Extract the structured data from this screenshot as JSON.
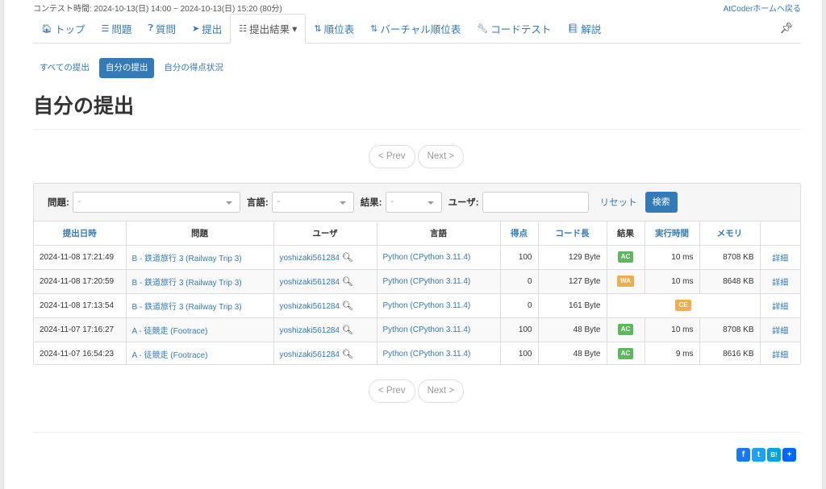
{
  "header": {
    "contest_time": "コンテスト時間: 2024-10-13(日) 14:00 ~ 2024-10-13(日) 15:20 (80分)",
    "home_link": "AtCoderホームへ戻る"
  },
  "nav": {
    "top": "トップ",
    "tasks": "問題",
    "clar": "質問",
    "submit": "提出",
    "results": "提出結果",
    "standings": "順位表",
    "virtual": "バーチャル順位表",
    "codetest": "コードテスト",
    "editorial": "解説"
  },
  "subnav": {
    "all": "すべての提出",
    "mine": "自分の提出",
    "score": "自分の得点状況"
  },
  "page_title": "自分の提出",
  "pager": {
    "prev": "< Prev",
    "next": "Next >"
  },
  "filter": {
    "task_label": "問題:",
    "task_value": "-",
    "lang_label": "言語:",
    "lang_value": "-",
    "status_label": "結果:",
    "status_value": "-",
    "user_label": "ユーザ:",
    "reset": "リセット",
    "search": "検索"
  },
  "table": {
    "headers": [
      "提出日時",
      "問題",
      "ユーザ",
      "言語",
      "得点",
      "コード長",
      "結果",
      "実行時間",
      "メモリ",
      ""
    ],
    "rows": [
      {
        "time": "2024-11-08 17:21:49",
        "task": "B - 鉄道旅行 3 (Railway Trip 3)",
        "user": "yoshizaki561284",
        "lang": "Python (CPython 3.11.4)",
        "score": "100",
        "len": "129 Byte",
        "status": "AC",
        "exec": "10 ms",
        "mem": "8708 KB",
        "detail": "詳細"
      },
      {
        "time": "2024-11-08 17:20:59",
        "task": "B - 鉄道旅行 3 (Railway Trip 3)",
        "user": "yoshizaki561284",
        "lang": "Python (CPython 3.11.4)",
        "score": "0",
        "len": "127 Byte",
        "status": "WA",
        "exec": "10 ms",
        "mem": "8648 KB",
        "detail": "詳細"
      },
      {
        "time": "2024-11-08 17:13:54",
        "task": "B - 鉄道旅行 3 (Railway Trip 3)",
        "user": "yoshizaki561284",
        "lang": "Python (CPython 3.11.4)",
        "score": "0",
        "len": "161 Byte",
        "status": "CE",
        "exec": "",
        "mem": "",
        "detail": "詳細"
      },
      {
        "time": "2024-11-07 17:16:27",
        "task": "A - 徒競走 (Footrace)",
        "user": "yoshizaki561284",
        "lang": "Python (CPython 3.11.4)",
        "score": "100",
        "len": "48 Byte",
        "status": "AC",
        "exec": "10 ms",
        "mem": "8708 KB",
        "detail": "詳細"
      },
      {
        "time": "2024-11-07 16:54:23",
        "task": "A - 徒競走 (Footrace)",
        "user": "yoshizaki561284",
        "lang": "Python (CPython 3.11.4)",
        "score": "100",
        "len": "48 Byte",
        "status": "AC",
        "exec": "9 ms",
        "mem": "8616 KB",
        "detail": "詳細"
      }
    ]
  },
  "share": {
    "hatena": "B!"
  }
}
